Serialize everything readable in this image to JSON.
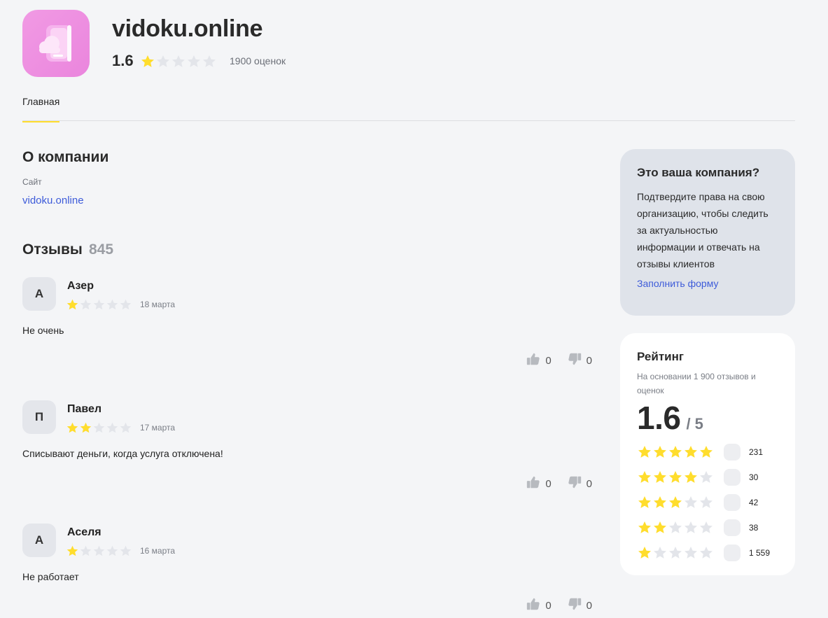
{
  "company": {
    "name": "vidoku.online",
    "score": "1.6",
    "stars": 1,
    "ratings_count": "1900 оценок"
  },
  "tabs": [
    {
      "label": "Главная"
    }
  ],
  "about": {
    "title": "О компании",
    "site_label": "Сайт",
    "site_value": "vidoku.online"
  },
  "reviews": {
    "title": "Отзывы",
    "count": "845",
    "items": [
      {
        "initial": "А",
        "name": "Азер",
        "stars": 1,
        "date": "18 марта",
        "text": "Не очень",
        "likes": "0",
        "dislikes": "0"
      },
      {
        "initial": "П",
        "name": "Павел",
        "stars": 2,
        "date": "17 марта",
        "text": "Списывают деньги, когда услуга отключена!",
        "likes": "0",
        "dislikes": "0"
      },
      {
        "initial": "А",
        "name": "Аселя",
        "stars": 1,
        "date": "16 марта",
        "text": "Не работает",
        "likes": "0",
        "dislikes": "0"
      }
    ]
  },
  "claim": {
    "title": "Это ваша компания?",
    "text": "Подтвердите права на свою организацию, чтобы следить за актуальностью информации и отвечать на отзывы клиентов",
    "link": "Заполнить форму"
  },
  "rating": {
    "title": "Рейтинг",
    "subtitle": "На основании 1 900 отзывов и оценок",
    "value": "1.6",
    "max": "/ 5",
    "distribution": [
      {
        "stars": 5,
        "count": "231"
      },
      {
        "stars": 4,
        "count": "30"
      },
      {
        "stars": 3,
        "count": "42"
      },
      {
        "stars": 2,
        "count": "38"
      },
      {
        "stars": 1,
        "count": "1 559"
      }
    ]
  },
  "colors": {
    "star_filled": "#ffdd2d",
    "star_empty": "#e3e5ea",
    "link": "#3d5bd9",
    "tab_underline": "#ffdd2d",
    "logo_bg": "#ef8fe2"
  },
  "icons": {
    "star": "star-icon",
    "like": "thumbs-up-icon",
    "dislike": "thumbs-down-icon"
  }
}
